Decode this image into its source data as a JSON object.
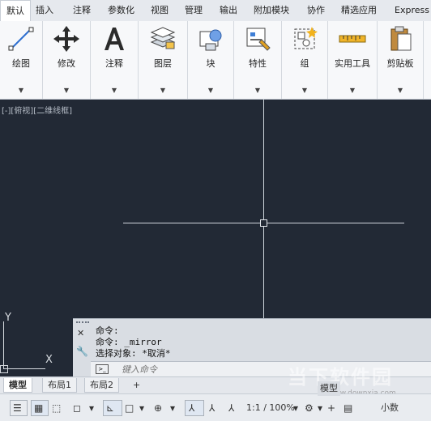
{
  "ribbon_tabs": [
    "默认",
    "插入",
    "注释",
    "参数化",
    "视图",
    "管理",
    "输出",
    "附加模块",
    "协作",
    "精选应用",
    "Express"
  ],
  "panels": [
    {
      "label": "绘图",
      "icon": "line-draw-icon"
    },
    {
      "label": "修改",
      "icon": "move-arrows-icon"
    },
    {
      "label": "注释",
      "icon": "text-a-icon"
    },
    {
      "label": "图层",
      "icon": "layers-icon"
    },
    {
      "label": "块",
      "icon": "block-icon"
    },
    {
      "label": "特性",
      "icon": "properties-icon"
    },
    {
      "label": "组",
      "icon": "group-icon"
    },
    {
      "label": "实用工具",
      "icon": "measure-ruler-icon"
    },
    {
      "label": "剪贴板",
      "icon": "clipboard-icon"
    }
  ],
  "viewport_label": "[-][俯视][二维线框]",
  "ucs": {
    "y": "Y",
    "x": "X"
  },
  "command": {
    "lines": [
      "命令:",
      "命令: _mirror",
      "选择对象: *取消*"
    ],
    "placeholder": "键入命令"
  },
  "layout_tabs": [
    "模型",
    "布局1",
    "布局2",
    "+"
  ],
  "status": {
    "model_button": "模型",
    "scale": "1:1 / 100%",
    "units": "小数"
  },
  "watermark": {
    "text": "当下软件园",
    "url": "www.downxia.com"
  }
}
